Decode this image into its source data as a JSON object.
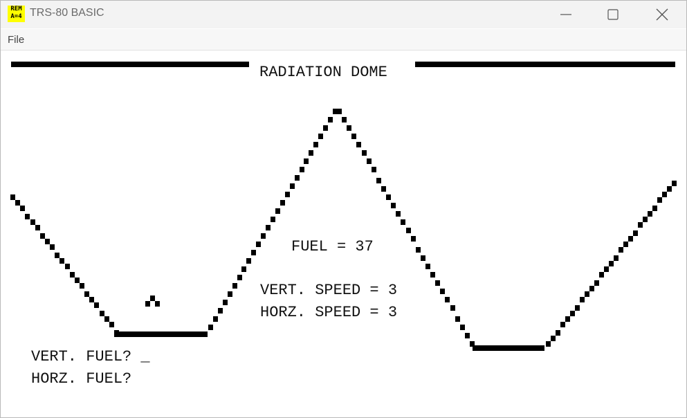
{
  "window": {
    "title": "TRS-80 BASIC",
    "icon_text_top": "REM",
    "icon_text_bottom": "A=4",
    "icon_color": "#ffff00"
  },
  "menu": {
    "file": "File"
  },
  "screen": {
    "heading": "RADIATION DOME",
    "fuel": "FUEL = 37",
    "vert_speed": "VERT. SPEED = 3",
    "horz_speed": "HORZ. SPEED = 3",
    "prompt_vert": "VERT. FUEL? _",
    "prompt_horz": "HORZ. FUEL?"
  }
}
